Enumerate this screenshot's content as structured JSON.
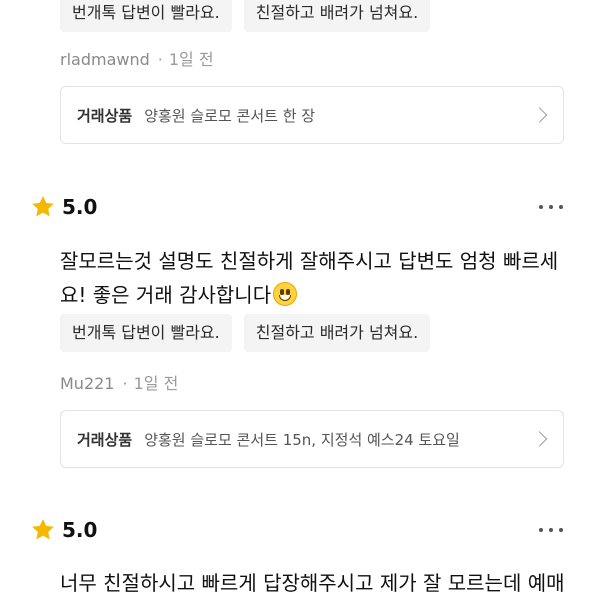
{
  "review_prev": {
    "tags": [
      "번개톡 답변이 빨라요.",
      "친절하고 배려가 넘쳐요."
    ],
    "user": "rladmawnd",
    "time": "1일 전",
    "product_label": "거래상품",
    "product_name": "양홍원 슬로모 콘서트 한 장"
  },
  "review_2": {
    "score": "5.0",
    "text_line1": "잘모르는것 설명도 친절하게 잘해주시고 답변도 엄청 빠르세",
    "text_line2": "요! 좋은 거래 감사합니다",
    "tags": [
      "번개톡 답변이 빨라요.",
      "친절하고 배려가 넘쳐요."
    ],
    "user": "Mu221",
    "time": "1일 전",
    "product_label": "거래상품",
    "product_name": "양홍원 슬로모 콘서트 15n, 지정석 예스24 토요일"
  },
  "review_3": {
    "score": "5.0",
    "text_line1": "너무 친절하시고 빠르게 답장해주시고 제가 잘 모르는데 예매"
  },
  "colors": {
    "star": "#f5b800",
    "tag_bg": "#f4f4f4",
    "border": "#e3e3e3",
    "meta": "#9a9a9a"
  },
  "icons": {
    "star": "star-icon",
    "more": "more-dots-icon",
    "chevron": "chevron-right-icon",
    "emoji": "grinning-face-emoji"
  }
}
